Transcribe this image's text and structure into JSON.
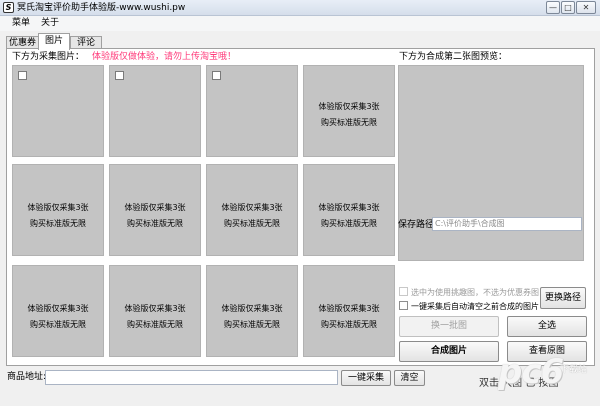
{
  "window": {
    "title": "冥氏淘宝评价助手体验版-www.wushi.pw",
    "app_icon": "S",
    "minimize": "—",
    "maximize": "□",
    "close": "✕"
  },
  "menu": {
    "items": [
      "菜单",
      "关于"
    ]
  },
  "tabs": [
    {
      "label": "优惠券",
      "active": false
    },
    {
      "label": "图片",
      "active": true
    },
    {
      "label": "评论",
      "active": false
    }
  ],
  "collect": {
    "label": "下方为采集图片：",
    "warning": "体验版仅做体验，请勿上传淘宝哦！",
    "tile_line1": "体验版仅采集3张",
    "tile_line2": "购买标准版无限"
  },
  "preview": {
    "label": "下方为合成第二张图预览："
  },
  "options": {
    "path_label": "保存路径：",
    "path_value": "C:\\评价助手\\合成图",
    "option1": "选中为使用挑趣图，不选为优惠券图",
    "option2": "一键采集后自动清空之前合成的图片",
    "change_path": "更换路径",
    "swap": "换一批图",
    "select_all": "全选",
    "compose": "合成图片",
    "view_original": "查看原图"
  },
  "bottom": {
    "url_label": "商品地址:",
    "url_value": "",
    "collect_button": "一键采集",
    "clear_button": "清空",
    "status_tail": "双击 大图 已 按图"
  },
  "watermark": {
    "logo": "pc6",
    "sub": "下载站"
  }
}
